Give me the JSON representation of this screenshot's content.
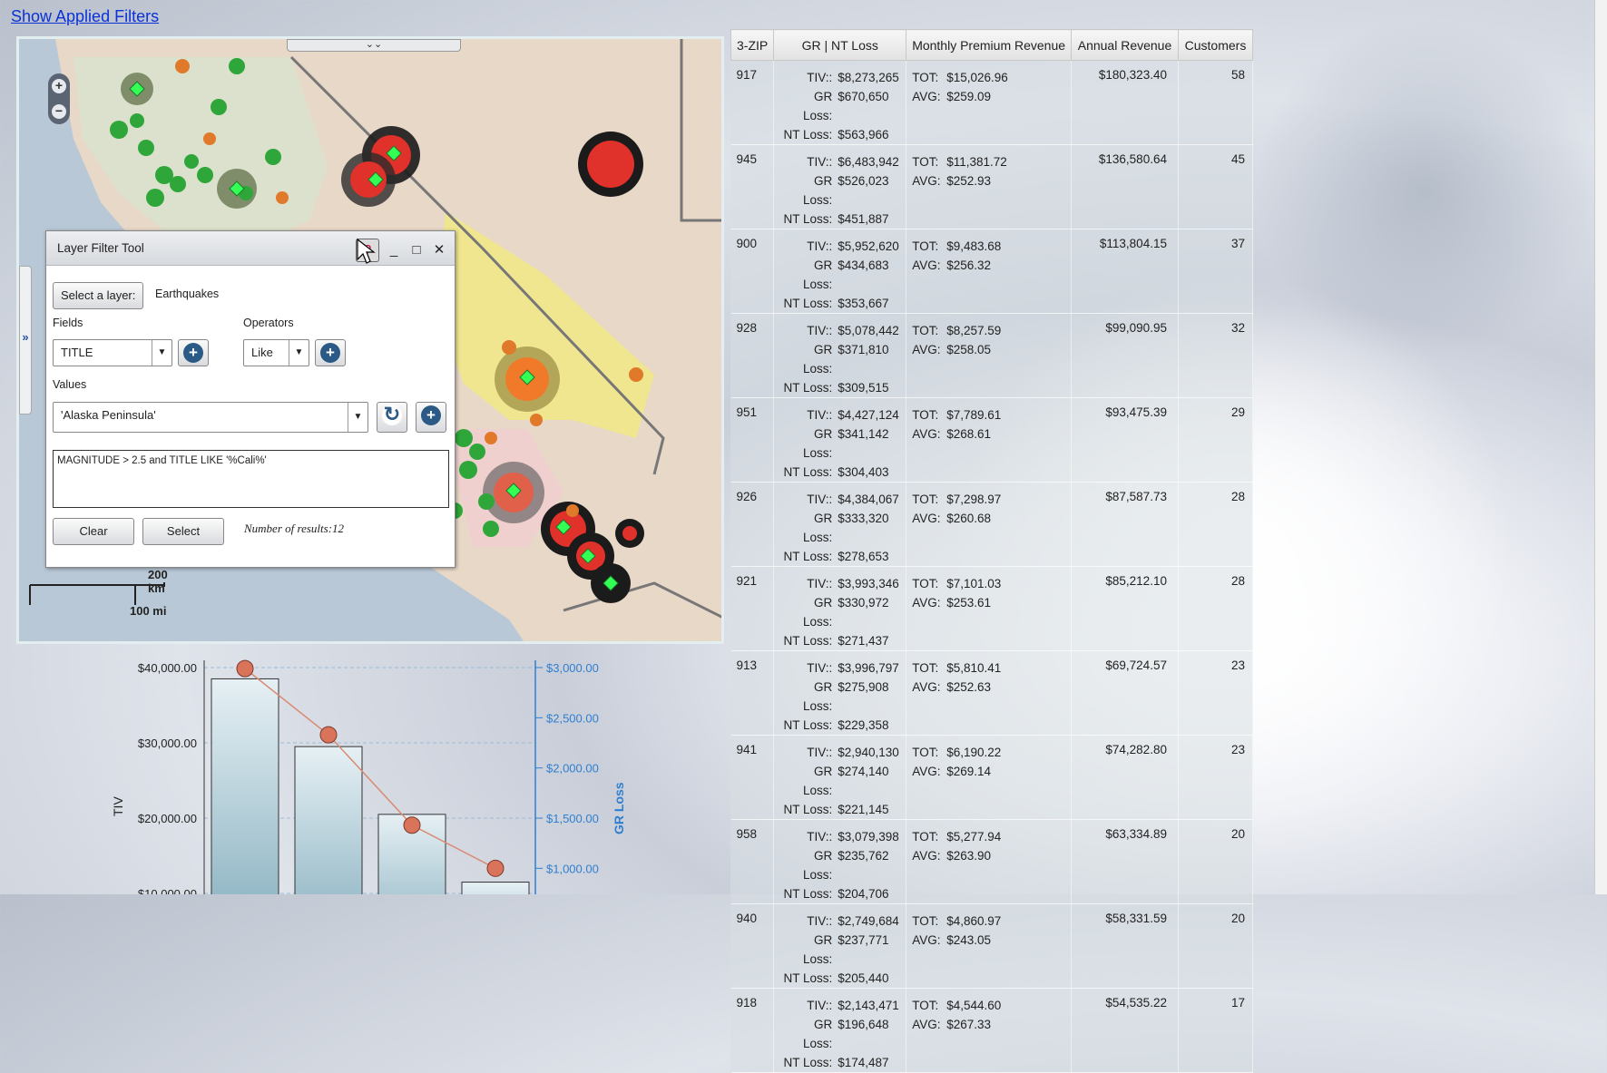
{
  "show_filters_link": "Show Applied Filters",
  "map": {
    "scale_km": "200 km",
    "scale_mi": "100 mi",
    "top_handle_glyph": "⌄⌄",
    "side_handle_glyph": "»"
  },
  "filter_tool": {
    "title": "Layer Filter Tool",
    "select_layer_button": "Select a layer:",
    "layer_name": "Earthquakes",
    "fields_label": "Fields",
    "field_value": "TITLE",
    "operators_label": "Operators",
    "operator_value": "Like",
    "values_label": "Values",
    "value_value": "'Alaska Peninsula'",
    "query": "MAGNITUDE > 2.5 and TITLE LIKE '%Cali%'",
    "clear_button": "Clear",
    "select_button": "Select",
    "result_text": "Number of results:12"
  },
  "table": {
    "headers": [
      "3-ZIP",
      "GR | NT Loss",
      "Monthly Premium Revenue",
      "Annual Revenue",
      "Customers"
    ],
    "loss_labels": [
      "TIV::",
      "GR Loss:",
      "NT Loss:"
    ],
    "prem_labels": [
      "TOT:",
      "AVG:"
    ],
    "rows": [
      {
        "zip": "917",
        "tiv": "$8,273,265",
        "gr": "$670,650",
        "nt": "$563,966",
        "tot": "$15,026.96",
        "avg": "$259.09",
        "rev": "$180,323.40",
        "cust": "58"
      },
      {
        "zip": "945",
        "tiv": "$6,483,942",
        "gr": "$526,023",
        "nt": "$451,887",
        "tot": "$11,381.72",
        "avg": "$252.93",
        "rev": "$136,580.64",
        "cust": "45"
      },
      {
        "zip": "900",
        "tiv": "$5,952,620",
        "gr": "$434,683",
        "nt": "$353,667",
        "tot": "$9,483.68",
        "avg": "$256.32",
        "rev": "$113,804.15",
        "cust": "37"
      },
      {
        "zip": "928",
        "tiv": "$5,078,442",
        "gr": "$371,810",
        "nt": "$309,515",
        "tot": "$8,257.59",
        "avg": "$258.05",
        "rev": "$99,090.95",
        "cust": "32"
      },
      {
        "zip": "951",
        "tiv": "$4,427,124",
        "gr": "$341,142",
        "nt": "$304,403",
        "tot": "$7,789.61",
        "avg": "$268.61",
        "rev": "$93,475.39",
        "cust": "29"
      },
      {
        "zip": "926",
        "tiv": "$4,384,067",
        "gr": "$333,320",
        "nt": "$278,653",
        "tot": "$7,298.97",
        "avg": "$260.68",
        "rev": "$87,587.73",
        "cust": "28"
      },
      {
        "zip": "921",
        "tiv": "$3,993,346",
        "gr": "$330,972",
        "nt": "$271,437",
        "tot": "$7,101.03",
        "avg": "$253.61",
        "rev": "$85,212.10",
        "cust": "28"
      },
      {
        "zip": "913",
        "tiv": "$3,996,797",
        "gr": "$275,908",
        "nt": "$229,358",
        "tot": "$5,810.41",
        "avg": "$252.63",
        "rev": "$69,724.57",
        "cust": "23"
      },
      {
        "zip": "941",
        "tiv": "$2,940,130",
        "gr": "$274,140",
        "nt": "$221,145",
        "tot": "$6,190.22",
        "avg": "$269.14",
        "rev": "$74,282.80",
        "cust": "23"
      },
      {
        "zip": "958",
        "tiv": "$3,079,398",
        "gr": "$235,762",
        "nt": "$204,706",
        "tot": "$5,277.94",
        "avg": "$263.90",
        "rev": "$63,334.89",
        "cust": "20"
      },
      {
        "zip": "940",
        "tiv": "$2,749,684",
        "gr": "$237,771",
        "nt": "$205,440",
        "tot": "$4,860.97",
        "avg": "$243.05",
        "rev": "$58,331.59",
        "cust": "20"
      },
      {
        "zip": "918",
        "tiv": "$2,143,471",
        "gr": "$196,648",
        "nt": "$174,487",
        "tot": "$4,544.60",
        "avg": "$267.33",
        "rev": "$54,535.22",
        "cust": "17"
      }
    ]
  },
  "chart_data": {
    "type": "bar",
    "ylabel": "TIV",
    "y2label": "GR Loss",
    "y_ticks": [
      "$10,000.00",
      "$20,000.00",
      "$30,000.00",
      "$40,000.00"
    ],
    "y2_ticks": [
      "$1,000.00",
      "$1,500.00",
      "$2,000.00",
      "$2,500.00",
      "$3,000.00"
    ],
    "ylim": [
      0,
      40000
    ],
    "y2lim": [
      0,
      3000
    ],
    "series": [
      {
        "values": [
          38500,
          29500,
          20500,
          11500
        ]
      },
      {
        "values": [
          2990,
          2330,
          1430,
          1000
        ]
      }
    ],
    "colors": {
      "bar": "#7aa7b8",
      "line": "#d98a73",
      "axis2": "#2f7fd0"
    }
  }
}
